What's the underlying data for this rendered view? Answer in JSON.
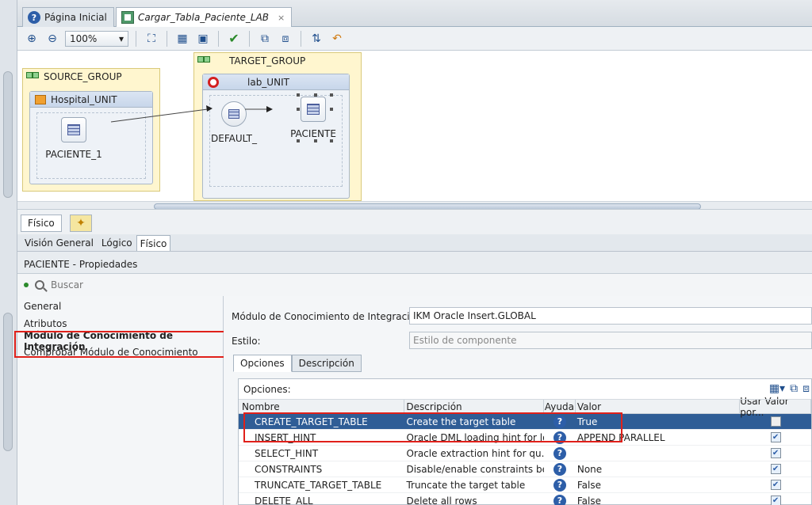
{
  "tabs": [
    {
      "label": "Página Inicial",
      "icon": "help-icon"
    },
    {
      "label": "Cargar_Tabla_Paciente_LAB",
      "icon": "mapping-icon",
      "close": "×"
    }
  ],
  "toolbar": {
    "zoom": "100%"
  },
  "canvas": {
    "source_group": "SOURCE_GROUP",
    "source_unit": "Hospital_UNIT",
    "source_node": "PACIENTE_1",
    "target_group": "TARGET_GROUP",
    "target_unit": "lab_UNIT",
    "default_node": "DEFAULT_",
    "target_node": "PACIENTE"
  },
  "editor_tabs": {
    "fisico": "Físico"
  },
  "view_tabs": [
    "Visión General",
    "Lógico",
    "Físico"
  ],
  "props": {
    "title": "PACIENTE - Propiedades",
    "search_placeholder": "Buscar",
    "nav": [
      "General",
      "Atributos",
      "Módulo de Conocimiento de Integración",
      "Comprobar Módulo de Conocimiento"
    ],
    "ikm_label": "Módulo de Conocimiento de Integración:",
    "ikm_value": "IKM Oracle Insert.GLOBAL",
    "style_label": "Estilo:",
    "style_placeholder": "Estilo de componente",
    "sub_tabs": [
      "Opciones",
      "Descripción"
    ],
    "options_title": "Opciones:",
    "columns": {
      "name": "Nombre",
      "desc": "Descripción",
      "help": "Ayuda",
      "value": "Valor",
      "use": "Usar Valor por..."
    },
    "rows": [
      {
        "name": "CREATE_TARGET_TABLE",
        "desc": "Create the target table",
        "value": "True",
        "use": false
      },
      {
        "name": "INSERT_HINT",
        "desc": "Oracle DML loading hint for lo...",
        "value": "APPEND PARALLEL",
        "use": true
      },
      {
        "name": "SELECT_HINT",
        "desc": "Oracle extraction hint for qu...",
        "value": "",
        "use": true
      },
      {
        "name": "CONSTRAINTS",
        "desc": "Disable/enable constraints be...",
        "value": "None",
        "use": true
      },
      {
        "name": "TRUNCATE_TARGET_TABLE",
        "desc": "Truncate the target table",
        "value": "False",
        "use": true
      },
      {
        "name": "DELETE_ALL",
        "desc": "Delete all rows",
        "value": "False",
        "use": true
      }
    ]
  },
  "colors": {
    "highlight_red": "#e0201a",
    "selection_blue": "#2f5d96",
    "group_yellow": "#fff6cf"
  }
}
